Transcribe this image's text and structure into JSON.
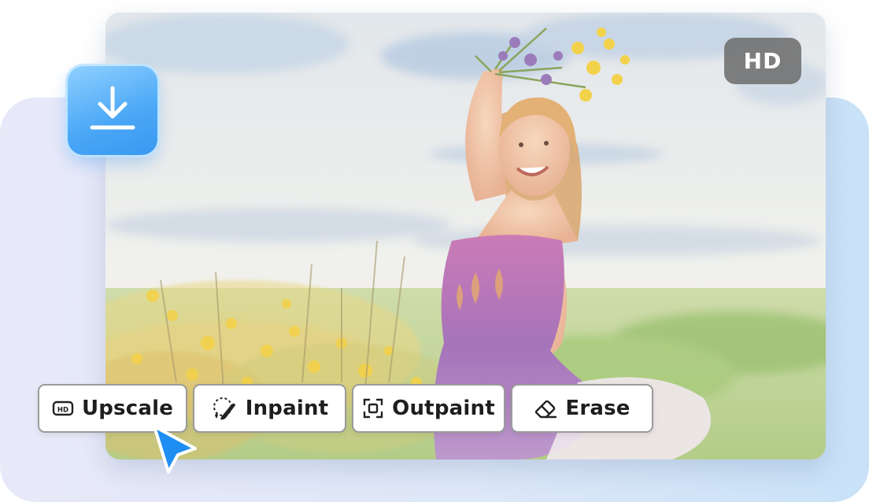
{
  "badge": {
    "label": "HD"
  },
  "toolbar": {
    "buttons": [
      {
        "label": "Upscale",
        "icon": "hd-icon"
      },
      {
        "label": "Inpaint",
        "icon": "brush-icon"
      },
      {
        "label": "Outpaint",
        "icon": "expand-frame-icon"
      },
      {
        "label": "Erase",
        "icon": "eraser-icon"
      }
    ]
  },
  "download": {
    "icon": "download-icon"
  },
  "colors": {
    "accent": "#3a98f0",
    "badge_bg": "#6e6e6e",
    "cursor": "#1e8ef3"
  }
}
